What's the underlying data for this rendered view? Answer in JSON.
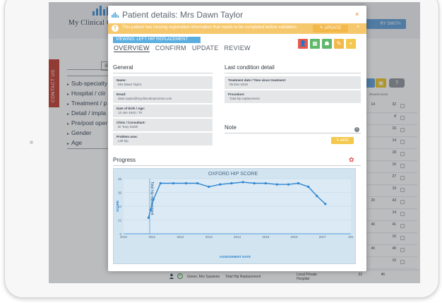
{
  "app": {
    "name": "My Clinical Out",
    "user_label": "RY SMITH",
    "contact_tab": "CONTACT US"
  },
  "filters": [
    {
      "label": "Sub-specialty"
    },
    {
      "label": "Hospital / clir"
    },
    {
      "label": "Treatment / p"
    },
    {
      "label": "Detail / impla"
    },
    {
      "label": "Pre/post oper"
    },
    {
      "label": "Gender"
    },
    {
      "label": "Age"
    }
  ],
  "background_table": {
    "header": "Recent score",
    "rows": [
      {
        "a": "14",
        "b": "32"
      },
      {
        "a": "",
        "b": "8"
      },
      {
        "a": "",
        "b": "16"
      },
      {
        "a": "",
        "b": "14"
      },
      {
        "a": "",
        "b": "18"
      },
      {
        "a": "",
        "b": "16"
      },
      {
        "a": "",
        "b": "27"
      },
      {
        "a": "",
        "b": "19"
      },
      {
        "a": "20",
        "b": "43"
      },
      {
        "a": "",
        "b": "14"
      },
      {
        "a": "40",
        "b": "41"
      },
      {
        "a": "",
        "b": "16"
      },
      {
        "a": "40",
        "b": "40"
      },
      {
        "a": "",
        "b": "10"
      },
      {
        "a": "40",
        "b": "39"
      }
    ],
    "bottom_row": {
      "name": "Green, Mrs Suzanne",
      "operation": "Total Hip Replacement",
      "hospital": "Local Private Hospital",
      "v1": "32",
      "v2": "46"
    }
  },
  "modal": {
    "title": "Patient details: Mrs Dawn Taylor",
    "alert": {
      "text": "This patient has missing registration information that needs to be completed before validation",
      "update_label": "UPDATE",
      "close": "×"
    },
    "close": "×",
    "viewing": "VIEWING: LEFT HIP REPLACEMENT",
    "tabs": [
      "OVERVIEW",
      "CONFIRM",
      "UPDATE",
      "REVIEW"
    ],
    "action_icons": [
      {
        "name": "patient-red-icon",
        "color": "#e8594a",
        "glyph": "👤"
      },
      {
        "name": "calendar-icon",
        "color": "#5fb86a",
        "glyph": "▦"
      },
      {
        "name": "team-icon",
        "color": "#5fb86a",
        "glyph": "☗"
      },
      {
        "name": "edit-patient-icon",
        "color": "#f3b84a",
        "glyph": "✎"
      },
      {
        "name": "user-add-icon",
        "color": "#f3c84d",
        "glyph": "+"
      }
    ],
    "general": {
      "heading": "General",
      "fields": [
        {
          "label": "Name:",
          "value": "Mrs Dawn Taylor"
        },
        {
          "label": "Email:",
          "value": "dawn.taylor@myclinicaloutcomes.com"
        },
        {
          "label": "Date of birth / Age:",
          "value": "12-Jan-1942 / 75"
        },
        {
          "label": "Clinic / Consultant:",
          "value": "Dr Tony Smith"
        },
        {
          "label": "Problem area:",
          "value": "Left hip"
        }
      ]
    },
    "condition": {
      "heading": "Last condition detail",
      "fields": [
        {
          "label": "Treatment date / Time since treatment:",
          "value": "05-Dec-2010"
        },
        {
          "label": "Procedure:",
          "value": "Total hip replacement"
        }
      ]
    },
    "note": {
      "heading": "Note",
      "add_label": "ADD"
    },
    "progress": {
      "heading": "Progress"
    }
  },
  "chart_data": {
    "type": "line",
    "title": "OXFORD HIP SCORE",
    "xlabel": "ASSESSMENT DATE",
    "ylabel": "SCORE",
    "x_ticks": [
      "2010",
      "2011",
      "2012",
      "2013",
      "2014",
      "2015",
      "2016",
      "2017",
      "201"
    ],
    "y_ticks": [
      0,
      12,
      24,
      36,
      48
    ],
    "ylim": [
      0,
      48
    ],
    "xlim": [
      2010,
      2018
    ],
    "series_color": "#2e86d0",
    "annotation": "Total hip replacement",
    "annotation_x": 2010.92,
    "x": [
      2010.88,
      2010.95,
      2011.05,
      2011.3,
      2011.75,
      2012.2,
      2012.6,
      2013.0,
      2013.4,
      2013.8,
      2014.2,
      2014.6,
      2015.0,
      2015.4,
      2015.8,
      2016.15,
      2016.5,
      2016.8,
      2017.1
    ],
    "y": [
      14,
      21,
      30,
      44,
      44,
      44,
      44,
      41,
      43,
      44,
      45,
      44,
      44,
      43,
      43,
      44,
      41,
      33,
      26,
      24
    ],
    "grid": true
  }
}
